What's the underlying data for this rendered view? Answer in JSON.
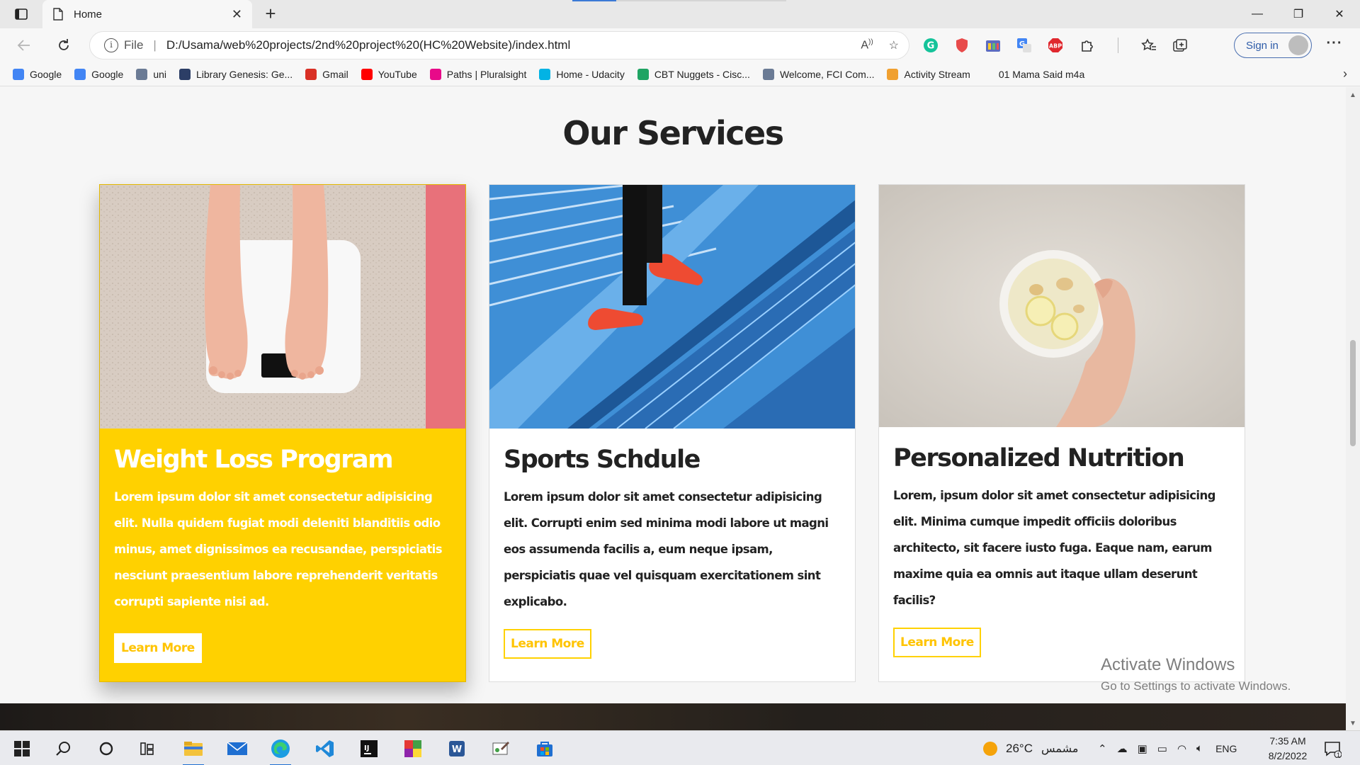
{
  "browser": {
    "tab_title": "Home",
    "url_scheme_label": "File",
    "url": "D:/Usama/web%20projects/2nd%20project%20(HC%20Website)/index.html",
    "signin_label": "Sign in",
    "read_aloud_icon": "read-aloud-icon",
    "bookmarks": [
      {
        "label": "Google",
        "icon": "google-icon",
        "color": "#4285f4"
      },
      {
        "label": "Google",
        "icon": "google-icon",
        "color": "#4285f4"
      },
      {
        "label": "uni",
        "icon": "uni-icon",
        "color": "#6b7b95"
      },
      {
        "label": "Library Genesis: Ge...",
        "icon": "libgen-icon",
        "color": "#2c3e66"
      },
      {
        "label": "Gmail",
        "icon": "gmail-icon",
        "color": "#d93025"
      },
      {
        "label": "YouTube",
        "icon": "youtube-icon",
        "color": "#ff0000"
      },
      {
        "label": "Paths | Pluralsight",
        "icon": "pluralsight-icon",
        "color": "#e80a89"
      },
      {
        "label": "Home - Udacity",
        "icon": "udacity-icon",
        "color": "#02b3e4"
      },
      {
        "label": "CBT Nuggets - Cisc...",
        "icon": "drive-icon",
        "color": "#1fa463"
      },
      {
        "label": "Welcome, FCI Com...",
        "icon": "fci-icon",
        "color": "#6b7b95"
      },
      {
        "label": "Activity Stream",
        "icon": "activity-stream-icon",
        "color": "#f0a030"
      },
      {
        "label": "01 Mama Said m4a",
        "icon": "",
        "color": ""
      }
    ]
  },
  "page": {
    "section_title": "Our Services",
    "cards": [
      {
        "title": "Weight Loss Program",
        "text": "Lorem ipsum dolor sit amet consectetur adipisicing elit. Nulla quidem fugiat modi deleniti blanditiis odio minus, amet dignissimos ea recusandae, perspiciatis nesciunt praesentium labore reprehenderit veritatis corrupti sapiente nisi ad.",
        "button": "Learn More",
        "image": "feet-on-scale-image",
        "featured": true
      },
      {
        "title": "Sports Schdule",
        "text": "Lorem ipsum dolor sit amet consectetur adipisicing elit. Corrupti enim sed minima modi labore ut magni eos assumenda facilis a, eum neque ipsam, perspiciatis quae vel quisquam exercitationem sint explicabo.",
        "button": "Learn More",
        "image": "running-stairs-image",
        "featured": false
      },
      {
        "title": "Personalized Nutrition",
        "text": "Lorem, ipsum dolor sit amet consectetur adipisicing elit. Minima cumque impedit officiis doloribus architecto, sit facere iusto fuga. Eaque nam, earum maxime quia ea omnis aut itaque ullam deserunt facilis?",
        "button": "Learn More",
        "image": "ginger-lemon-tea-image",
        "featured": false
      }
    ],
    "watermark_line1": "Activate Windows",
    "watermark_line2": "Go to Settings to activate Windows."
  },
  "colors": {
    "accent_yellow": "#ffd100",
    "button_text": "#ffc400",
    "heading": "#222222"
  },
  "taskbar": {
    "weather_temp": "26°C",
    "weather_desc": "مشمس",
    "language": "ENG",
    "time": "7:35 AM",
    "date": "8/2/2022",
    "notification_count": "1",
    "apps": [
      "windows-start-icon",
      "search-icon",
      "cortana-icon",
      "task-view-icon",
      "file-explorer-icon",
      "mail-icon",
      "edge-icon",
      "vscode-icon",
      "intellij-icon",
      "colorful-app-icon",
      "word-icon",
      "paint-icon",
      "store-icon"
    ]
  }
}
